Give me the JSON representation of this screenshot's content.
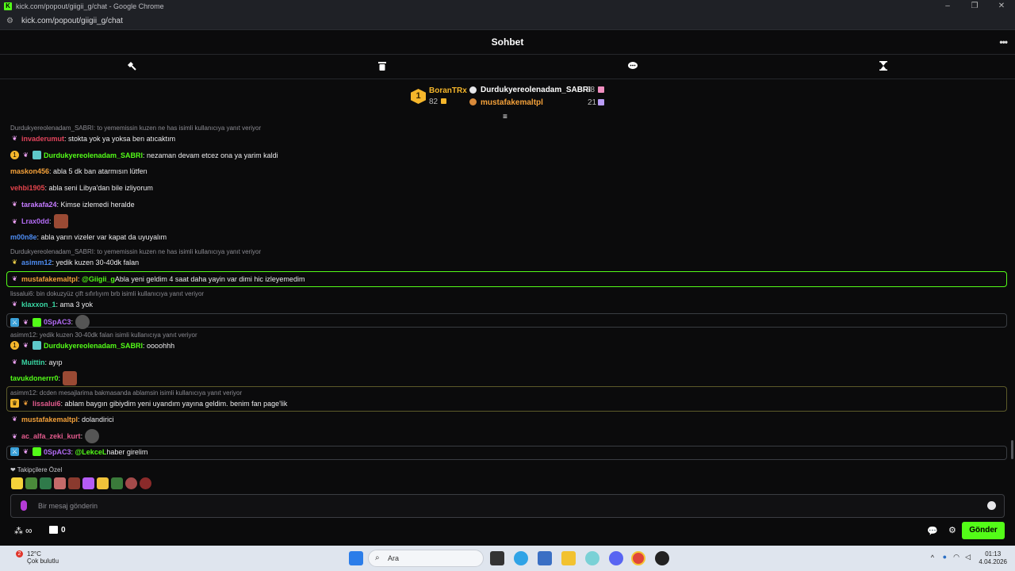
{
  "browser": {
    "window_title": "kick.com/popout/giigii_g/chat - Google Chrome",
    "url": "kick.com/popout/giigii_g/chat",
    "favicon_letter": "K"
  },
  "chat": {
    "title": "Sohbet",
    "mod_icons": [
      "hammer-icon",
      "trash-icon",
      "chat-bubble-icon",
      "hourglass-icon"
    ]
  },
  "leaderboard": {
    "first": {
      "rank": "1",
      "name": "BoranTRx",
      "count": "82"
    },
    "second": {
      "name": "Durdukyereolenadam_SABRI",
      "count": "28"
    },
    "third": {
      "name": "mustafakemaltpl",
      "count": "21"
    }
  },
  "messages": [
    {
      "reply": "Durdukyereolenadam_SABRI: to yememissin kuzen ne has isimli kullanıcıya yanıt veriyor",
      "user": "invaderumut",
      "color": "#e4445c",
      "text": ": stokta yok ya yoksa ben atıcaktım"
    },
    {
      "user": "Durdukyereolenadam_SABRI",
      "color": "#53fc18",
      "text": ": nezaman devam etcez ona ya yarim kaldi"
    },
    {
      "user": "maskon456",
      "color": "#f4a13a",
      "text": ": abla 5 dk ban atarmısın lütfen"
    },
    {
      "user": "vehbi1905",
      "color": "#e4444c",
      "text": ": abla seni Libya'dan bile izliyorum"
    },
    {
      "user": "tarakafa24",
      "color": "#c47bff",
      "text": ": Kimse izlemedi heralde"
    },
    {
      "user": "Lrax0dd",
      "color": "#b36cf5",
      "text": ":"
    },
    {
      "user": "m00n8e",
      "color": "#4d8bf0",
      "text": ": abla yarın vizeler var kapat da uyuyalım"
    },
    {
      "reply": "Durdukyereolenadam_SABRI: to yememissin kuzen ne has isimli kullanıcıya yanıt veriyor",
      "user": "asimm12",
      "color": "#4d8bf0",
      "text": ": yedik kuzen 30-40dk falan"
    },
    {
      "user": "mustafakemaltpl",
      "color": "#f4a13a",
      "mention": "@Giigii_g",
      "text": " Abla yeni geldim 4 saat daha yayin var dimi hic izleyemedim"
    },
    {
      "reply": "lissalui6: bin dokuzyüz çift sıfırlıyım brb isimli kullanıcıya yanıt veriyor",
      "user": "klaxxon_1",
      "color": "#39d6a3",
      "text": ": ama 3 yok"
    },
    {
      "user": "0SpAC3",
      "color": "#b36cf5",
      "text": ":"
    },
    {
      "reply": "asimm12: yedik kuzen 30-40dk falan isimli kullanıcıya yanıt veriyor",
      "user": "Durdukyereolenadam_SABRI",
      "color": "#53fc18",
      "text": ": oooohhh"
    },
    {
      "user": "Muittin",
      "color": "#39d6a3",
      "text": ": ayıp"
    },
    {
      "user": "tavukdonerrr0",
      "color": "#53fc18",
      "text": ":"
    },
    {
      "reply": "asimm12: dcden mesajlarima bakmasanda ablamsin isimli kullanıcıya yanıt veriyor",
      "user": "lissalui6",
      "color": "#e45b8e",
      "text": ": ablam baygın gibiydim yeni uyandım yayına geldim. benim fan page'lik"
    },
    {
      "user": "mustafakemaltpl",
      "color": "#f4a13a",
      "text": ": dolandirici"
    },
    {
      "user": "ac_alfa_zeki_kurt",
      "color": "#e45b8e",
      "text": ":"
    },
    {
      "user": "0SpAC3",
      "color": "#b36cf5",
      "mention": "@LekceL",
      "text": " haber girelim"
    }
  ],
  "followers_only_label": "Takipçilere Özel",
  "input": {
    "placeholder": "Bir mesaj gönderin"
  },
  "bottom": {
    "infinity_label": "∞",
    "points": "0",
    "send_label": "Gönder"
  },
  "taskbar": {
    "temp": "12°C",
    "weather": "Çok bulutlu",
    "weather_badge": "2",
    "search_placeholder": "Ara",
    "time": "01:13",
    "date": "4.04.2026"
  },
  "colors": {
    "accent": "#53fc18",
    "background": "#0b0b0c"
  }
}
